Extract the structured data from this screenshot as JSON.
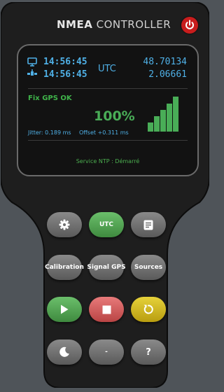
{
  "header": {
    "title_bold": "NMEA",
    "title_light": "CONTROLLER"
  },
  "display": {
    "system_time": "14:56:45",
    "gps_time": "14:56:45",
    "timezone": "UTC",
    "latitude": "48.70134",
    "longitude": "2.06661",
    "fix_status": "Fix GPS OK",
    "signal_percent": "100%",
    "signal_level": 1.0,
    "jitter_label": "Jitter: 0.189 ms",
    "offset_label": "Offset +0.311 ms",
    "service_status": "Service NTP : Démarré"
  },
  "buttons": {
    "settings": {
      "icon": "gear-icon"
    },
    "utc": {
      "label": "UTC"
    },
    "log": {
      "icon": "document-icon"
    },
    "calibration": {
      "label": "Calibration"
    },
    "signal_gps": {
      "label": "Signal GPS"
    },
    "sources": {
      "label": "Sources"
    },
    "play": {
      "icon": "play-icon"
    },
    "stop": {
      "icon": "stop-icon"
    },
    "restart": {
      "icon": "restart-icon"
    },
    "theme": {
      "icon": "moon-icon"
    },
    "dash": {
      "label": "-"
    },
    "help": {
      "label": "?"
    }
  },
  "colors": {
    "accent_blue": "#4fb0e6",
    "status_green": "#49ad57",
    "power_red": "#c81d1d",
    "button_green": "#4f9f4f",
    "button_red": "#d25a5a",
    "button_yellow": "#d4bb20",
    "button_gray": "#727272"
  }
}
